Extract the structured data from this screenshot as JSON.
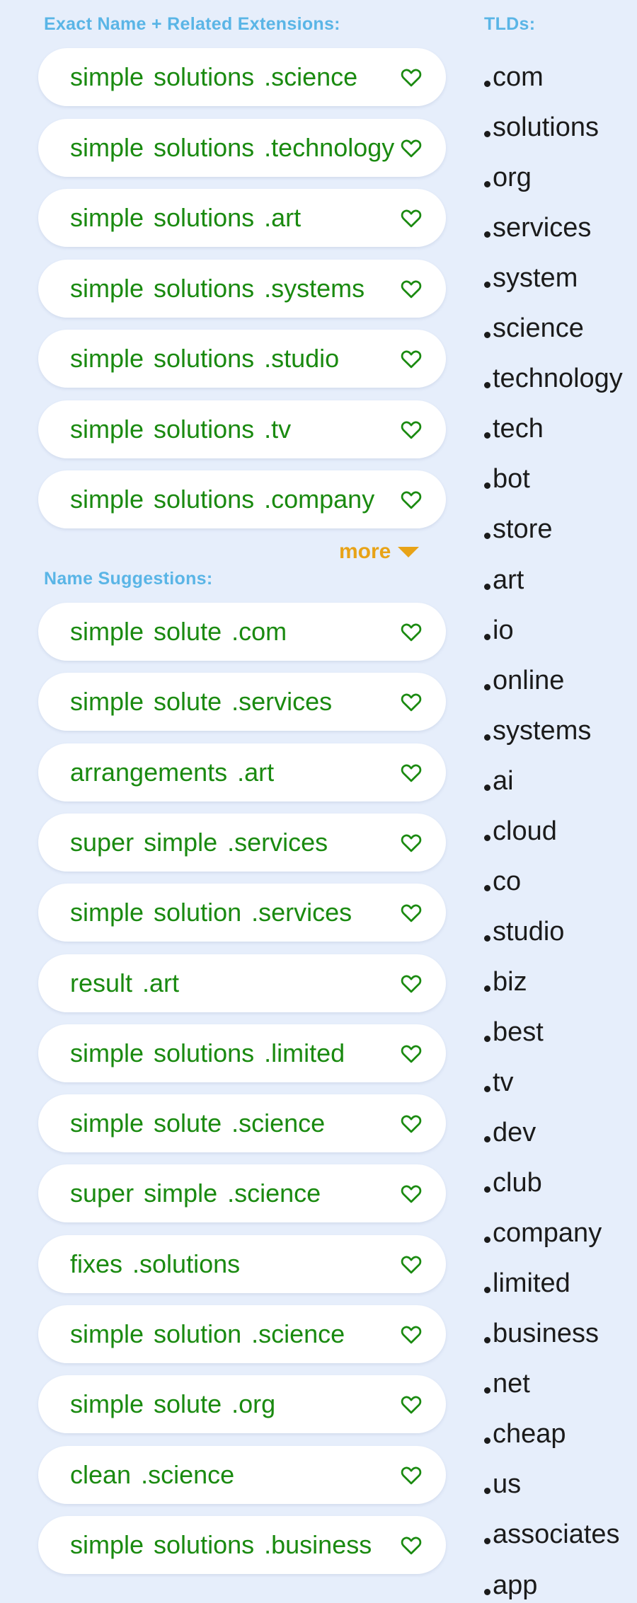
{
  "sections": {
    "exact_heading": "Exact Name + Related Extensions:",
    "suggestions_heading": "Name Suggestions:",
    "tlds_heading": "TLDs:",
    "more_label": "more"
  },
  "exact_domains": [
    {
      "parts": [
        "simple",
        "solutions"
      ],
      "tld": ".science"
    },
    {
      "parts": [
        "simple",
        "solutions"
      ],
      "tld": ".technology"
    },
    {
      "parts": [
        "simple",
        "solutions"
      ],
      "tld": ".art"
    },
    {
      "parts": [
        "simple",
        "solutions"
      ],
      "tld": ".systems"
    },
    {
      "parts": [
        "simple",
        "solutions"
      ],
      "tld": ".studio"
    },
    {
      "parts": [
        "simple",
        "solutions"
      ],
      "tld": ".tv"
    },
    {
      "parts": [
        "simple",
        "solutions"
      ],
      "tld": ".company"
    }
  ],
  "suggestions": [
    {
      "parts": [
        "simple",
        "solute"
      ],
      "tld": ".com"
    },
    {
      "parts": [
        "simple",
        "solute"
      ],
      "tld": ".services"
    },
    {
      "parts": [
        "arrangements"
      ],
      "tld": ".art"
    },
    {
      "parts": [
        "super",
        "simple"
      ],
      "tld": ".services"
    },
    {
      "parts": [
        "simple",
        "solution"
      ],
      "tld": ".services"
    },
    {
      "parts": [
        "result"
      ],
      "tld": ".art"
    },
    {
      "parts": [
        "simple",
        "solutions"
      ],
      "tld": ".limited"
    },
    {
      "parts": [
        "simple",
        "solute"
      ],
      "tld": ".science"
    },
    {
      "parts": [
        "super",
        "simple"
      ],
      "tld": ".science"
    },
    {
      "parts": [
        "fixes"
      ],
      "tld": ".solutions"
    },
    {
      "parts": [
        "simple",
        "solution"
      ],
      "tld": ".science"
    },
    {
      "parts": [
        "simple",
        "solute"
      ],
      "tld": ".org"
    },
    {
      "parts": [
        "clean"
      ],
      "tld": ".science"
    },
    {
      "parts": [
        "simple",
        "solutions"
      ],
      "tld": ".business"
    }
  ],
  "tlds": [
    "com",
    "solutions",
    "org",
    "services",
    "system",
    "science",
    "technology",
    "tech",
    "bot",
    "store",
    "art",
    "io",
    "online",
    "systems",
    "ai",
    "cloud",
    "co",
    "studio",
    "biz",
    "best",
    "tv",
    "dev",
    "club",
    "company",
    "limited",
    "business",
    "net",
    "cheap",
    "us",
    "associates",
    "app"
  ],
  "icons": {
    "favorite": "heart-outline-icon",
    "expand": "caret-down-icon"
  },
  "colors": {
    "background": "#e6eefb",
    "heading": "#5ab5e6",
    "domain_text": "#1a8a10",
    "heart": "#1a8a10",
    "more": "#e8a317",
    "tld_text": "#1b1b1b"
  }
}
